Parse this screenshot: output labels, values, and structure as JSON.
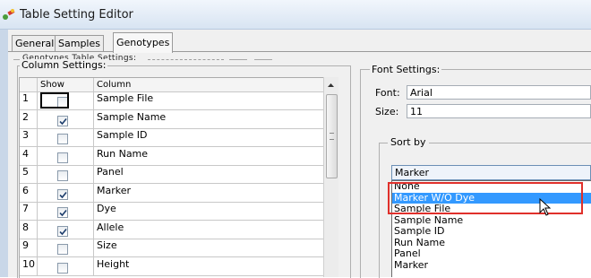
{
  "window": {
    "title": "Table Setting Editor",
    "icon": "app-icon"
  },
  "tabs": [
    {
      "label": "General",
      "active": false
    },
    {
      "label": "Samples",
      "active": false
    },
    {
      "label": "Genotypes",
      "active": true
    }
  ],
  "genotypes_table_settings": {
    "legend": "Genotypes Table Settings:",
    "column_settings": {
      "legend": "Column Settings:",
      "headers": {
        "number": "",
        "show": "Show",
        "column": "Column"
      },
      "rows": [
        {
          "num": "1",
          "show": false,
          "column": "Sample File",
          "focused": true
        },
        {
          "num": "2",
          "show": true,
          "column": "Sample Name"
        },
        {
          "num": "3",
          "show": false,
          "column": "Sample ID"
        },
        {
          "num": "4",
          "show": false,
          "column": "Run Name"
        },
        {
          "num": "5",
          "show": false,
          "column": "Panel"
        },
        {
          "num": "6",
          "show": true,
          "column": "Marker"
        },
        {
          "num": "7",
          "show": true,
          "column": "Dye"
        },
        {
          "num": "8",
          "show": true,
          "column": "Allele"
        },
        {
          "num": "9",
          "show": false,
          "column": "Size"
        },
        {
          "num": "10",
          "show": false,
          "column": "Height"
        }
      ]
    }
  },
  "font_settings": {
    "legend": "Font Settings:",
    "font_label": "Font:",
    "font_value": "Arial",
    "size_label": "Size:",
    "size_value": "11"
  },
  "sort_by": {
    "legend": "Sort by",
    "selected": "Marker",
    "options": [
      "None",
      "Marker W/O Dye",
      "Sample File",
      "Sample Name",
      "Sample ID",
      "Run Name",
      "Panel",
      "Marker"
    ],
    "highlighted": "Marker W/O Dye"
  },
  "colors": {
    "selection": "#3399ff",
    "annotation_box": "#e0302b",
    "title_bar": "#dde7f3"
  }
}
